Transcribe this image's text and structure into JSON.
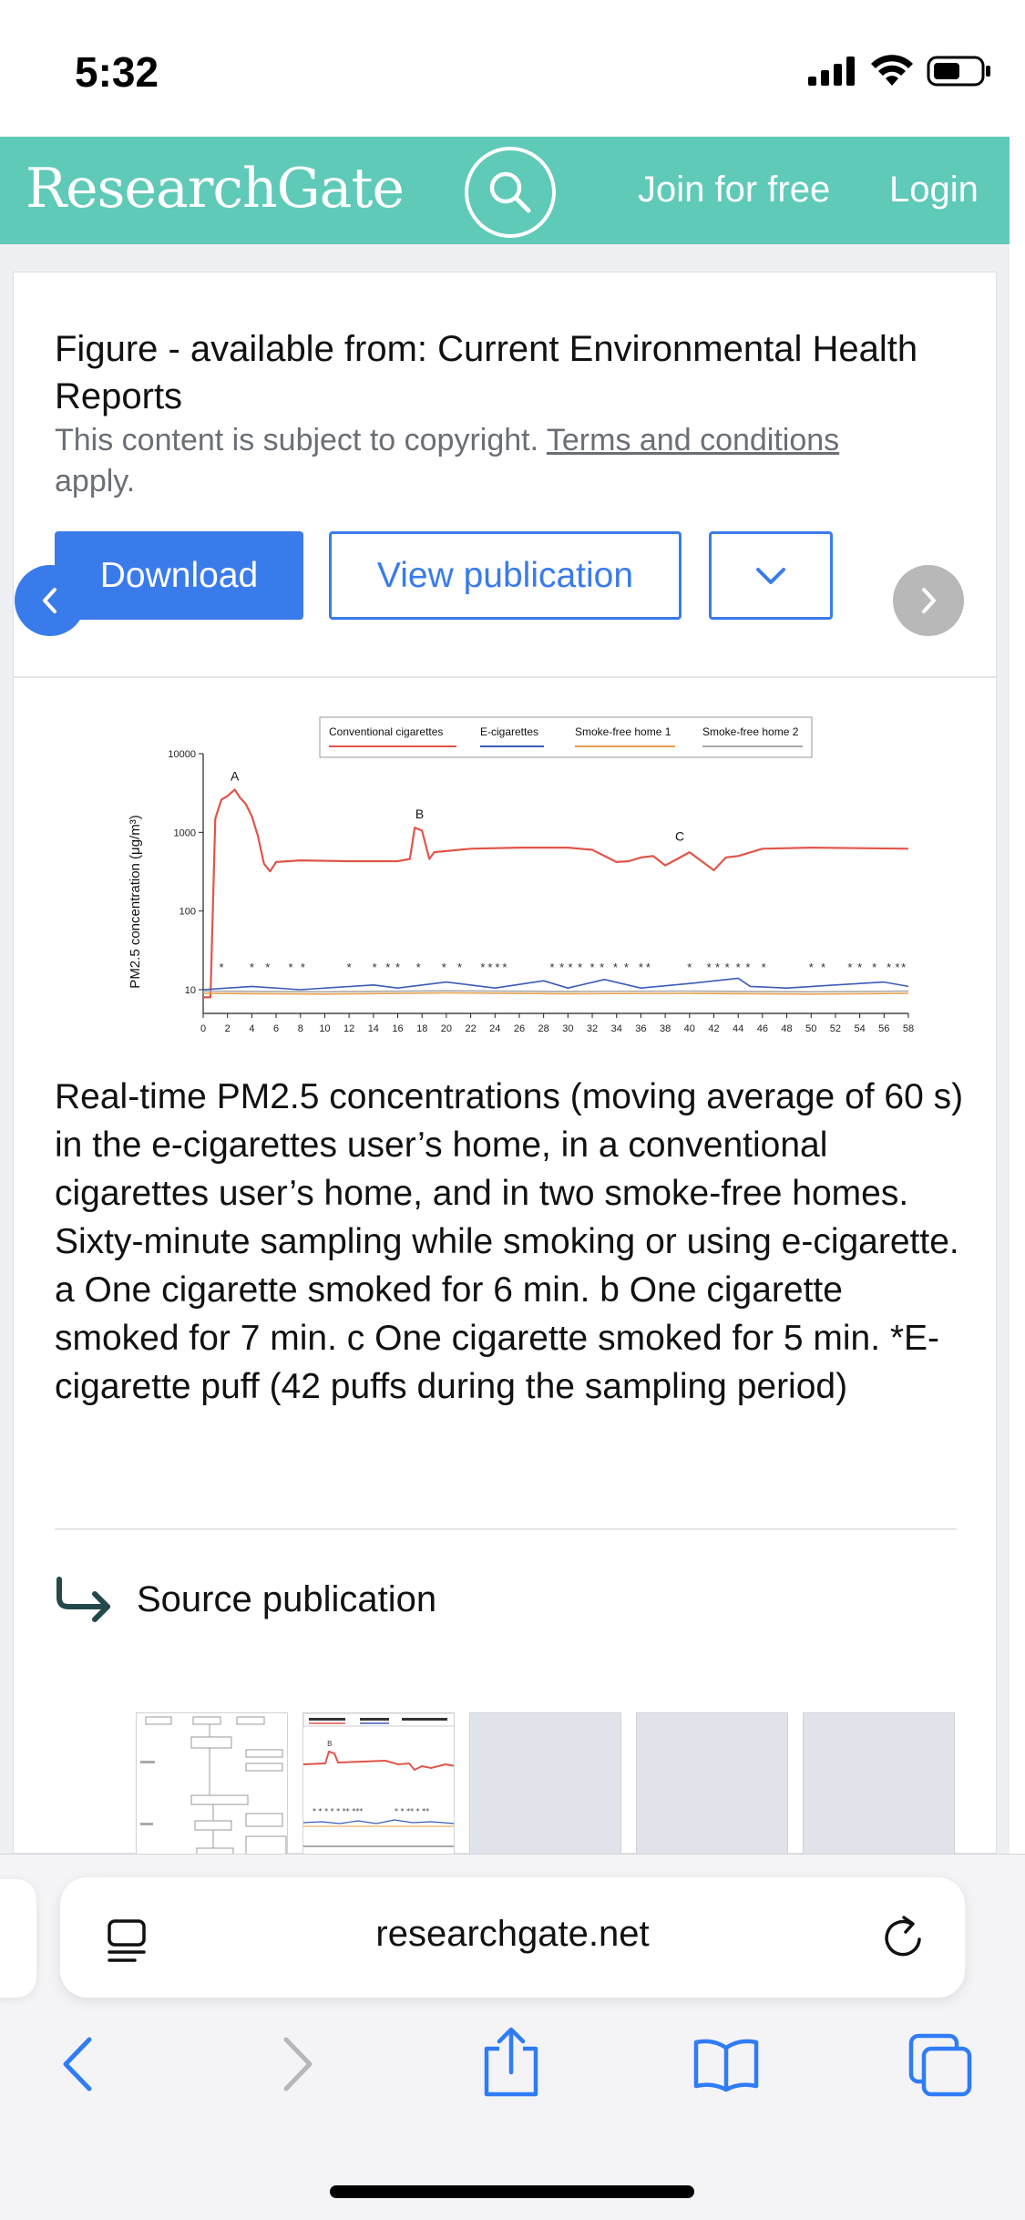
{
  "status_bar": {
    "time": "5:32"
  },
  "header": {
    "logo": "ResearchGate",
    "join_label": "Join for free",
    "login_label": "Login",
    "brand_color": "#5ecab7"
  },
  "figure_card": {
    "title": "Figure - available from: Current Environmental Health Reports",
    "copyright_prefix": "This content is subject to copyright.",
    "copyright_link": "Terms and conditions",
    "copyright_suffix": "apply.",
    "download_label": "Download",
    "view_publication_label": "View publication",
    "accent_color": "#3a7bec"
  },
  "chart_data": {
    "type": "line",
    "xlabel": "",
    "ylabel": "PM2.5 concentration (μg/m³)",
    "y_scale": "log",
    "ylim": [
      5,
      10000
    ],
    "xlim": [
      0,
      58
    ],
    "x_ticks": [
      "0",
      "2",
      "4",
      "6",
      "8",
      "10",
      "12",
      "14",
      "16",
      "18",
      "20",
      "22",
      "24",
      "26",
      "28",
      "30",
      "32",
      "34",
      "36",
      "38",
      "40",
      "42",
      "44",
      "46",
      "48",
      "50",
      "52",
      "54",
      "56",
      "58"
    ],
    "y_ticks": [
      "10",
      "100",
      "1000",
      "10000"
    ],
    "annotations": [
      {
        "text": "A",
        "x": 2.6,
        "y": 3500
      },
      {
        "text": "B",
        "x": 17.8,
        "y": 1150
      },
      {
        "text": "C",
        "x": 39.2,
        "y": 600
      }
    ],
    "legend": [
      "Conventional cigarettes",
      "E-cigarettes",
      "Smoke-free home 1",
      "Smoke-free home 2"
    ],
    "legend_placement": "top-center",
    "series": [
      {
        "name": "Conventional cigarettes",
        "color": "#e0554a",
        "x": [
          0,
          0.6,
          1,
          1.5,
          2,
          2.6,
          3,
          3.5,
          4,
          4.5,
          5,
          5.5,
          6,
          8,
          12,
          16,
          17,
          17.4,
          18,
          18.6,
          19,
          22,
          26,
          30,
          32,
          34,
          35,
          36,
          37,
          38,
          39,
          40,
          41,
          42,
          43,
          44,
          46,
          50,
          54,
          58
        ],
        "y": [
          8,
          8,
          1500,
          2600,
          2900,
          3500,
          2800,
          2300,
          1600,
          900,
          400,
          320,
          420,
          440,
          430,
          430,
          460,
          1150,
          1050,
          460,
          560,
          620,
          640,
          640,
          600,
          420,
          430,
          480,
          500,
          380,
          460,
          560,
          430,
          330,
          480,
          500,
          620,
          640,
          630,
          620
        ]
      },
      {
        "name": "E-cigarettes",
        "color": "#3b5cb8",
        "x": [
          0,
          4,
          8,
          14,
          16,
          20,
          24,
          28,
          30,
          33,
          36,
          40,
          44,
          45,
          48,
          52,
          56,
          58
        ],
        "y": [
          10,
          11,
          10,
          11.5,
          10.5,
          12.5,
          10.5,
          13,
          10.5,
          13.5,
          10.5,
          12,
          14,
          11,
          10.5,
          11.5,
          12.5,
          11
        ]
      },
      {
        "name": "Smoke-free home 1",
        "color": "#e8a04a",
        "x": [
          0,
          10,
          20,
          30,
          40,
          50,
          58
        ],
        "y": [
          9,
          8.8,
          9.1,
          8.9,
          9,
          8.8,
          9
        ]
      },
      {
        "name": "Smoke-free home 2",
        "color": "#a9a9a9",
        "x": [
          0,
          10,
          20,
          30,
          40,
          50,
          58
        ],
        "y": [
          9.6,
          9.4,
          9.7,
          9.5,
          9.6,
          9.4,
          9.6
        ]
      }
    ],
    "puff_marker": "*",
    "puffs_x": [
      1.5,
      4,
      5.3,
      7.2,
      8.2,
      12,
      14.1,
      15.2,
      16,
      17.7,
      19.8,
      21.1,
      23,
      23.6,
      24.2,
      24.8,
      28.7,
      29.5,
      30.2,
      31,
      32,
      32.8,
      33.9,
      34.8,
      36,
      36.6,
      40,
      41.6,
      42.3,
      43.1,
      44,
      44.8,
      46.1,
      50,
      51,
      53.2,
      54,
      55.2,
      56.4,
      57.1,
      57.6
    ],
    "grid": false
  },
  "caption": "Real-time PM2.5 concentrations (moving average of 60 s) in the e-cigarettes user’s home, in a conventional cigarettes user’s home, and in two smoke-free homes. Sixty-minute sampling while smoking or using e-cigarette. a One cigarette smoked for 6 min. b One cigarette smoked for 7 min. c One cigarette smoked for 5 min. *E-cigarette puff (42 puffs during the sampling period)",
  "source_publication": {
    "label": "Source publication"
  },
  "browser": {
    "url": "researchgate.net"
  },
  "icons": {
    "search": "search-icon",
    "chevron_down": "chevron-down-icon",
    "prev": "chevron-left-icon",
    "next": "chevron-right-icon",
    "source_arrow": "corner-down-right-icon",
    "reader": "reader-mode-icon",
    "reload": "reload-icon",
    "back": "back-icon",
    "forward": "forward-icon",
    "share": "share-icon",
    "bookmarks": "bookmarks-icon",
    "tabs": "tabs-icon"
  }
}
